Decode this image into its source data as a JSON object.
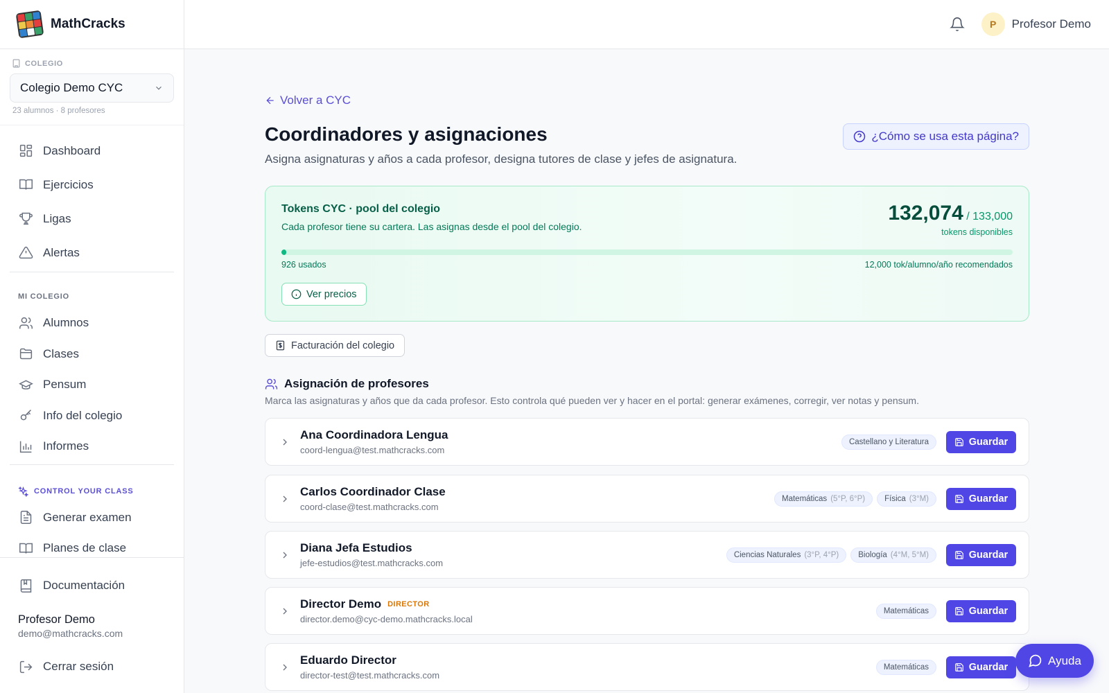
{
  "brand": {
    "name": "MathCracks"
  },
  "school": {
    "label": "COLEGIO",
    "selected": "Colegio Demo CYC",
    "meta": "23 alumnos · 8 profesores"
  },
  "nav": {
    "main": [
      {
        "label": "Dashboard",
        "icon": "dashboard-icon"
      },
      {
        "label": "Ejercicios",
        "icon": "book-icon"
      },
      {
        "label": "Ligas",
        "icon": "trophy-icon"
      },
      {
        "label": "Alertas",
        "icon": "alert-icon"
      }
    ],
    "school_section": "MI COLEGIO",
    "school_items": [
      {
        "label": "Alumnos",
        "icon": "users-icon"
      },
      {
        "label": "Clases",
        "icon": "folder-icon"
      },
      {
        "label": "Pensum",
        "icon": "graduation-cap-icon"
      },
      {
        "label": "Info del colegio",
        "icon": "key-icon"
      },
      {
        "label": "Informes",
        "icon": "bar-chart-icon"
      }
    ],
    "control_section": "CONTROL YOUR CLASS",
    "control_items": [
      {
        "label": "Generar examen",
        "icon": "file-text-icon"
      },
      {
        "label": "Planes de clase",
        "icon": "book-open-icon"
      }
    ]
  },
  "sidebar_bottom": {
    "docs": "Documentación",
    "user_name": "Profesor Demo",
    "user_email": "demo@mathcracks.com",
    "logout": "Cerrar sesión"
  },
  "topbar": {
    "avatar_initial": "P",
    "user_name": "Profesor Demo"
  },
  "page": {
    "back": "Volver a CYC",
    "title": "Coordinadores y asignaciones",
    "subtitle": "Asigna asignaturas y años a cada profesor, designa tutores de clase y jefes de asignatura.",
    "help": "¿Cómo se usa esta página?"
  },
  "tokens": {
    "title": "Tokens CYC · pool del colegio",
    "description": "Cada profesor tiene su cartera. Las asignas desde el pool del colegio.",
    "available": "132,074",
    "total": "/ 133,000",
    "caption": "tokens disponibles",
    "used_fraction": 0.007,
    "used_label": "926 usados",
    "recommended": "12,000 tok/alumno/año recomendados",
    "prices_button": "Ver precios"
  },
  "billing_button": "Facturación del colegio",
  "assignment": {
    "title": "Asignación de profesores",
    "description": "Marca las asignaturas y años que da cada profesor. Esto controla qué pueden ver y hacer en el portal: generar exámenes, corregir, ver notas y pensum.",
    "save_label": "Guardar",
    "teachers": [
      {
        "name": "Ana Coordinadora Lengua",
        "role": "",
        "email": "coord-lengua@test.mathcracks.com",
        "chips": [
          {
            "subject": "Castellano y Literatura",
            "years": ""
          }
        ]
      },
      {
        "name": "Carlos Coordinador Clase",
        "role": "",
        "email": "coord-clase@test.mathcracks.com",
        "chips": [
          {
            "subject": "Matemáticas",
            "years": "(5°P, 6°P)"
          },
          {
            "subject": "Física",
            "years": "(3°M)"
          }
        ]
      },
      {
        "name": "Diana Jefa Estudios",
        "role": "",
        "email": "jefe-estudios@test.mathcracks.com",
        "chips": [
          {
            "subject": "Ciencias Naturales",
            "years": "(3°P, 4°P)"
          },
          {
            "subject": "Biología",
            "years": "(4°M, 5°M)"
          }
        ]
      },
      {
        "name": "Director Demo",
        "role": "DIRECTOR",
        "email": "director.demo@cyc-demo.mathcracks.local",
        "chips": [
          {
            "subject": "Matemáticas",
            "years": ""
          }
        ]
      },
      {
        "name": "Eduardo Director",
        "role": "",
        "email": "director-test@test.mathcracks.com",
        "chips": [
          {
            "subject": "Matemáticas",
            "years": ""
          }
        ]
      }
    ]
  },
  "help_fab": "Ayuda",
  "colors": {
    "accent": "#4f46e5",
    "success": "#10b981",
    "role": "#d97706"
  }
}
